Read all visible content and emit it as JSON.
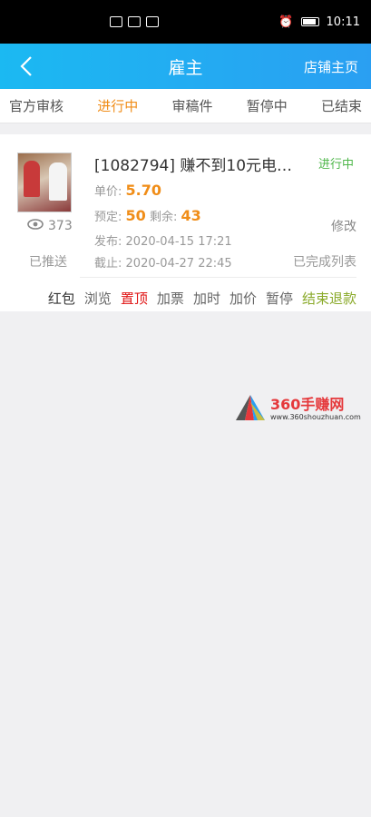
{
  "status_bar": {
    "time": "10:11"
  },
  "header": {
    "title": "雇主",
    "store_link": "店铺主页"
  },
  "tabs": [
    {
      "label": "官方审核",
      "active": false
    },
    {
      "label": "进行中",
      "active": true
    },
    {
      "label": "审稿件",
      "active": false
    },
    {
      "label": "暂停中",
      "active": false
    },
    {
      "label": "已结束",
      "active": false
    }
  ],
  "task": {
    "title": "[1082794] 赚不到10元电…",
    "status": "进行中",
    "price_label": "单价:",
    "price": "5.70",
    "booked_label": "预定:",
    "booked": "50",
    "remaining_label": "剩余:",
    "remaining": "43",
    "published_label": "发布:",
    "published": "2020-04-15 17:21",
    "deadline_label": "截止:",
    "deadline": "2020-04-27 22:45",
    "views": "373",
    "pushed": "已推送",
    "edit": "修改",
    "done_list": "已完成列表"
  },
  "actions": [
    {
      "label": "红包",
      "style": "dark"
    },
    {
      "label": "浏览",
      "style": "normal"
    },
    {
      "label": "置顶",
      "style": "red"
    },
    {
      "label": "加票",
      "style": "normal"
    },
    {
      "label": "加时",
      "style": "normal"
    },
    {
      "label": "加价",
      "style": "normal"
    },
    {
      "label": "暂停",
      "style": "normal"
    },
    {
      "label": "结束退款",
      "style": "green"
    }
  ],
  "watermark": {
    "name": "360手赚网",
    "url": "www.360shouzhuan.com"
  },
  "colors": {
    "header": "#1bb9f2",
    "accent": "#f08d18",
    "active_status": "#4cb648",
    "red": "#e01515"
  }
}
